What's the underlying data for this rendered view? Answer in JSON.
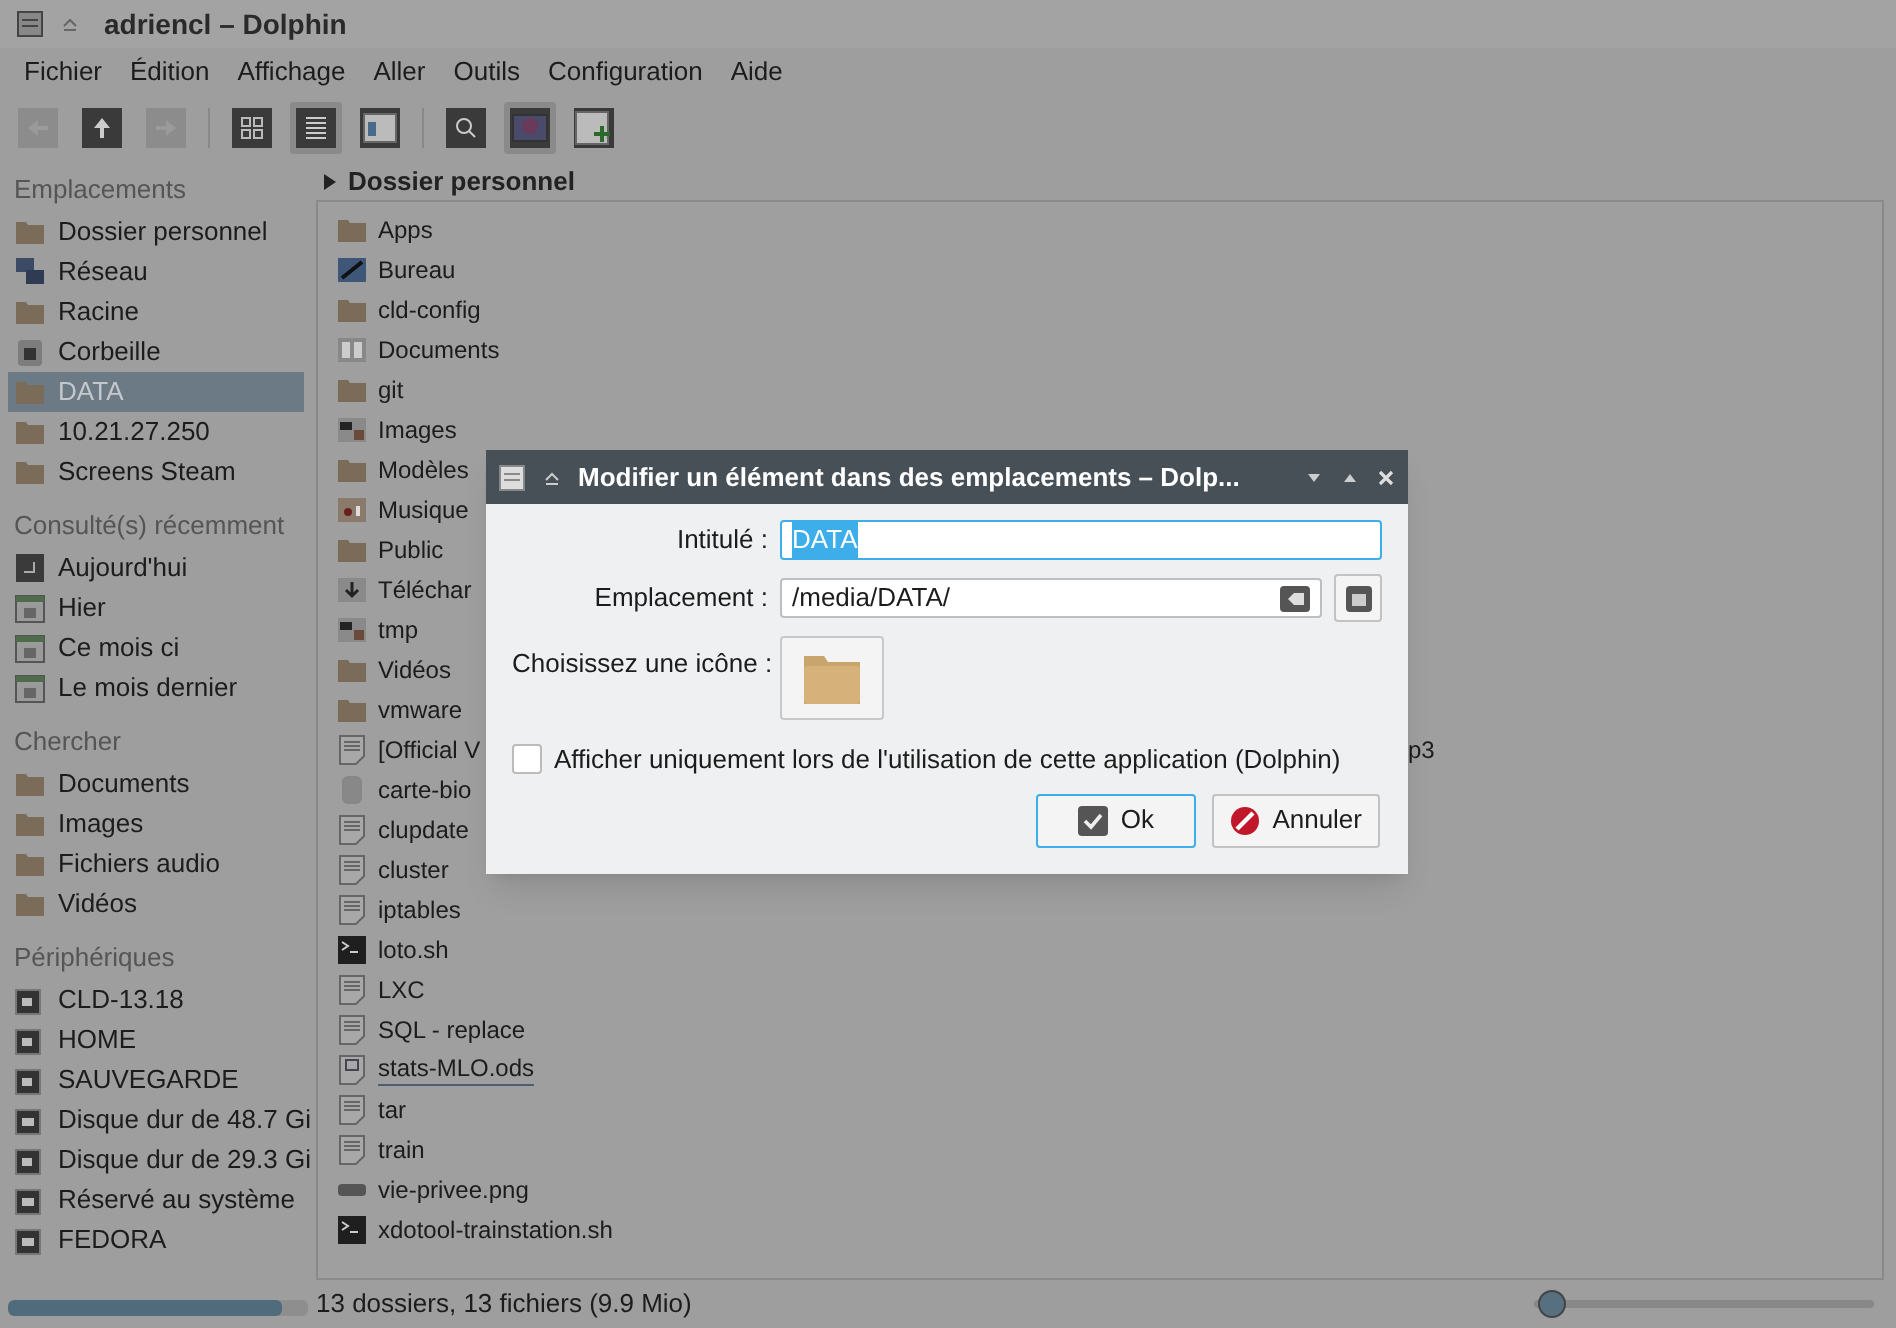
{
  "window": {
    "title": "adriencl – Dolphin"
  },
  "menu": [
    "Fichier",
    "Édition",
    "Affichage",
    "Aller",
    "Outils",
    "Configuration",
    "Aide"
  ],
  "toolbar": [
    {
      "kind": "back",
      "disabled": true,
      "pressed": false
    },
    {
      "kind": "up",
      "disabled": false,
      "pressed": false
    },
    {
      "kind": "forward",
      "disabled": true,
      "pressed": false
    },
    {
      "kind": "sep"
    },
    {
      "kind": "icons",
      "disabled": false,
      "pressed": false
    },
    {
      "kind": "details",
      "disabled": false,
      "pressed": true
    },
    {
      "kind": "split",
      "disabled": false,
      "pressed": false
    },
    {
      "kind": "sep"
    },
    {
      "kind": "search",
      "disabled": false,
      "pressed": false
    },
    {
      "kind": "preview",
      "disabled": false,
      "pressed": true
    },
    {
      "kind": "newpanel",
      "disabled": false,
      "pressed": false
    }
  ],
  "sidebar": [
    {
      "title": "Emplacements",
      "items": [
        {
          "label": "Dossier personnel",
          "kind": "home",
          "selected": false
        },
        {
          "label": "Réseau",
          "kind": "network",
          "selected": false
        },
        {
          "label": "Racine",
          "kind": "folder",
          "selected": false
        },
        {
          "label": "Corbeille",
          "kind": "trash",
          "selected": false
        },
        {
          "label": "DATA",
          "kind": "folder",
          "selected": true
        },
        {
          "label": "10.21.27.250",
          "kind": "folder",
          "selected": false
        },
        {
          "label": "Screens Steam",
          "kind": "folder",
          "selected": false
        }
      ]
    },
    {
      "title": "Consulté(s) récemment",
      "items": [
        {
          "label": "Aujourd'hui",
          "kind": "recent",
          "selected": false
        },
        {
          "label": "Hier",
          "kind": "calendar",
          "selected": false
        },
        {
          "label": "Ce mois ci",
          "kind": "calendar",
          "selected": false
        },
        {
          "label": "Le mois dernier",
          "kind": "calendar",
          "selected": false
        }
      ]
    },
    {
      "title": "Chercher",
      "items": [
        {
          "label": "Documents",
          "kind": "folder",
          "selected": false
        },
        {
          "label": "Images",
          "kind": "folder",
          "selected": false
        },
        {
          "label": "Fichiers audio",
          "kind": "folder",
          "selected": false
        },
        {
          "label": "Vidéos",
          "kind": "folder",
          "selected": false
        }
      ]
    },
    {
      "title": "Périphériques",
      "items": [
        {
          "label": "CLD-13.18",
          "kind": "drive",
          "selected": false
        },
        {
          "label": "HOME",
          "kind": "drive",
          "selected": false
        },
        {
          "label": "SAUVEGARDE",
          "kind": "drive",
          "selected": false
        },
        {
          "label": "Disque dur de 48.7 Gi",
          "kind": "disk",
          "selected": false
        },
        {
          "label": "Disque dur de 29.3 Gi",
          "kind": "drive",
          "selected": false
        },
        {
          "label": "Réservé au système",
          "kind": "disk",
          "selected": false
        },
        {
          "label": "FEDORA",
          "kind": "disk",
          "selected": false
        }
      ]
    }
  ],
  "capacity": {
    "level": 0.91
  },
  "breadcrumb": "Dossier personnel",
  "files": [
    {
      "name": "Apps",
      "kind": "folder"
    },
    {
      "name": "Bureau",
      "kind": "desktop"
    },
    {
      "name": "cld-config",
      "kind": "folder"
    },
    {
      "name": "Documents",
      "kind": "documents"
    },
    {
      "name": "git",
      "kind": "folder"
    },
    {
      "name": "Images",
      "kind": "images"
    },
    {
      "name": "Modèles",
      "kind": "folder"
    },
    {
      "name": "Musique",
      "kind": "music"
    },
    {
      "name": "Public",
      "kind": "folder"
    },
    {
      "name": "Téléchar",
      "kind": "downloads"
    },
    {
      "name": "tmp",
      "kind": "images"
    },
    {
      "name": "Vidéos",
      "kind": "folder"
    },
    {
      "name": "vmware",
      "kind": "folder"
    },
    {
      "name": "[Official V",
      "kind": "text",
      "tail": "p3"
    },
    {
      "name": "carte-bio",
      "kind": "blob"
    },
    {
      "name": "clupdate",
      "kind": "text"
    },
    {
      "name": "cluster",
      "kind": "text"
    },
    {
      "name": "iptables",
      "kind": "text"
    },
    {
      "name": "loto.sh",
      "kind": "script"
    },
    {
      "name": "LXC",
      "kind": "text"
    },
    {
      "name": "SQL - replace",
      "kind": "text"
    },
    {
      "name": "stats-MLO.ods",
      "kind": "spreadsheet",
      "hovered": true
    },
    {
      "name": "tar",
      "kind": "text"
    },
    {
      "name": "train",
      "kind": "text"
    },
    {
      "name": "vie-privee.png",
      "kind": "image"
    },
    {
      "name": "xdotool-trainstation.sh",
      "kind": "script"
    }
  ],
  "status": "13 dossiers, 13 fichiers (9.9 Mio)",
  "zoom": {
    "level": 0.03
  },
  "dialog": {
    "title": "Modifier un élément dans des emplacements – Dolp...",
    "label_field": {
      "label": "Intitulé :",
      "value": "DATA",
      "text_selected": true
    },
    "location_field": {
      "label": "Emplacement :",
      "value": "/media/DATA/"
    },
    "icon_label": "Choisissez une icône :",
    "checkbox": {
      "label": "Afficher uniquement lors de l'utilisation de cette application (Dolphin)",
      "checked": false
    },
    "buttons": [
      {
        "label": "Ok",
        "kind": "ok",
        "focused": true
      },
      {
        "label": "Annuler",
        "kind": "cancel",
        "focused": false
      }
    ]
  }
}
